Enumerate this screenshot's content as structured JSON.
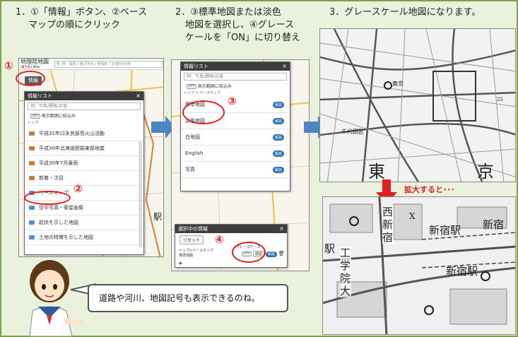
{
  "steps": {
    "step1_line1": "1．①「情報」ボタン、②ベース",
    "step1_line2": "マップの順にクリック",
    "step2_line1": "2．③標準地図または淡色",
    "step2_line2": "地図を選択し、④グレース",
    "step2_line3": "ケールを「ON」に切り替え",
    "step3_line1": "3．グレースケール地図になります。"
  },
  "markers": {
    "m1": "①",
    "m2": "②",
    "m3": "③",
    "m4": "④"
  },
  "app": {
    "logo_line1": "地理院地図",
    "logo_line2": "(電子国土Web)",
    "search_placeholder": "例：駿島 | 金沢市木 / 新保町 | 35度0分0秒",
    "info_button": "情報"
  },
  "infolist": {
    "title": "情報リスト",
    "close": "×",
    "search_placeholder": "例：写真/標高/災害",
    "toggle": "OFF",
    "range_label": "表示範囲に絞込み",
    "top_label": "トップ",
    "items": [
      "平成31年口永良部島火山活動",
      "平成30年北海道胆振東部地震",
      "平成30年7月豪雨",
      "新着・注目",
      "ベースマップ",
      "空中写真・衛星画像",
      "起伏を示した地図",
      "土地の特徴を示した地図"
    ]
  },
  "basemap": {
    "title": "情報リスト",
    "close": "×",
    "search_placeholder": "例：写真/標高/災害",
    "toggle": "OFF",
    "range_label": "表示範囲に絞込み",
    "breadcrumb": "トップ > ベースマップ",
    "desc_label": "解説",
    "items": [
      "標準地図",
      "淡色地図",
      "白地図",
      "English",
      "写真"
    ]
  },
  "selected": {
    "title": "選択中の情報",
    "close": "×",
    "reset": "リセット",
    "path": "トップ>ベースマップ",
    "name": "標準地図",
    "grayscale_label": "グレースケール",
    "toggle": "OFF",
    "opacity": "透過",
    "desc": "解説",
    "zoom_plus": "+"
  },
  "map3": {
    "station": "東京",
    "big1": "東",
    "big2": "京",
    "num": "25",
    "cap": "千代田区"
  },
  "zoom": {
    "label": "拡大すると･･･"
  },
  "map4": {
    "station1": "新宿駅",
    "station2": "新宿駅",
    "station3": "新宿",
    "vert1": "西新宿",
    "vert2": "工学院大",
    "side": "駅",
    "x": "X"
  },
  "speech": {
    "text": "道路や河川、地図記号も表示できるのね。"
  },
  "colors": {
    "accent": "#e02020",
    "frame": "#7aa244",
    "arrow": "#4a86c5"
  }
}
